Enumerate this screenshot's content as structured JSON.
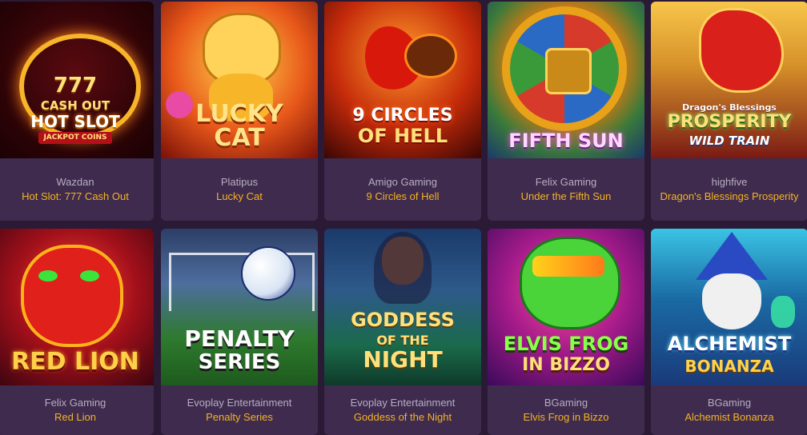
{
  "games": [
    {
      "provider": "Wazdan",
      "title": "Hot Slot: 777 Cash Out",
      "logo_lines": [
        "777",
        "CASH OUT",
        "HOT SLOT",
        "JACKPOT COINS"
      ]
    },
    {
      "provider": "Platipus",
      "title": "Lucky Cat",
      "logo_lines": [
        "LUCKY",
        "CAT"
      ]
    },
    {
      "provider": "Amigo Gaming",
      "title": "9 Circles of Hell",
      "logo_lines": [
        "9 CIRCLES",
        "of HELL"
      ]
    },
    {
      "provider": "Felix Gaming",
      "title": "Under the Fifth Sun",
      "logo_lines": [
        "FIFTH SUN"
      ]
    },
    {
      "provider": "highfive",
      "title": "Dragon's Blessings Prosperity",
      "logo_lines": [
        "Dragon's Blessings",
        "PROSPERITY",
        "WILD TRAIN"
      ]
    },
    {
      "provider": "Felix Gaming",
      "title": "Red Lion",
      "logo_lines": [
        "RED LION"
      ]
    },
    {
      "provider": "Evoplay Entertainment",
      "title": "Penalty Series",
      "logo_lines": [
        "PENALTY",
        "SERIES"
      ]
    },
    {
      "provider": "Evoplay Entertainment",
      "title": "Goddess of the Night",
      "logo_lines": [
        "GODDESS",
        "OF THE",
        "NIGHT"
      ]
    },
    {
      "provider": "BGaming",
      "title": "Elvis Frog in Bizzo",
      "logo_lines": [
        "ELVIS FROG",
        "IN BIZZO"
      ]
    },
    {
      "provider": "BGaming",
      "title": "Alchemist Bonanza",
      "logo_lines": [
        "ALCHEMIST",
        "BONANZA"
      ]
    }
  ]
}
